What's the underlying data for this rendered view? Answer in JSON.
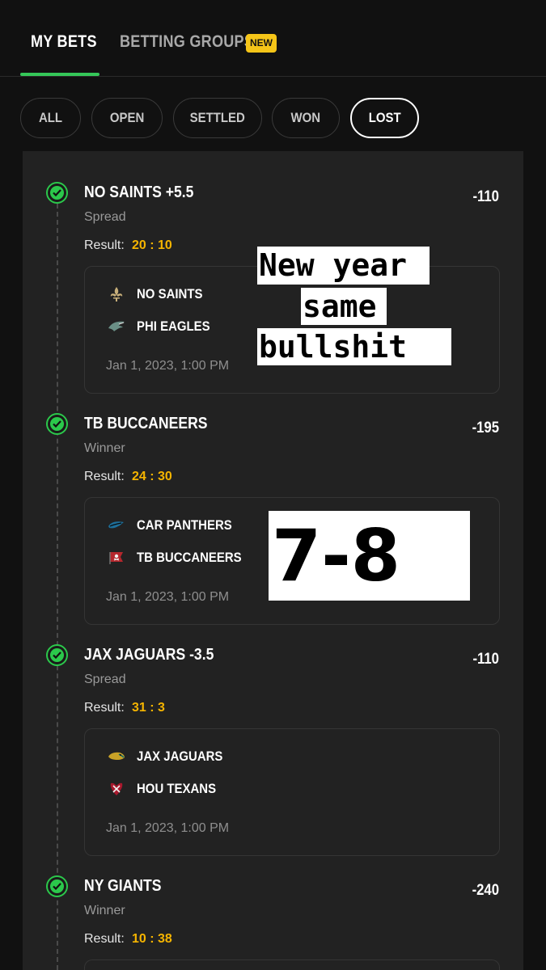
{
  "nav": {
    "tabs": [
      {
        "label": "MY BETS"
      },
      {
        "label": "BETTING GROUPS"
      }
    ],
    "new_badge": "NEW"
  },
  "filters": {
    "chips": [
      {
        "label": "ALL"
      },
      {
        "label": "OPEN"
      },
      {
        "label": "SETTLED"
      },
      {
        "label": "WON"
      },
      {
        "label": "LOST"
      }
    ],
    "selected": "LOST"
  },
  "bets": [
    {
      "title": "NO SAINTS +5.5",
      "odds": "-110",
      "type": "Spread",
      "result_label": "Result:",
      "result": "20 : 10",
      "teams": [
        {
          "name": "NO SAINTS",
          "icon": "saints-fleur-de-lis-icon"
        },
        {
          "name": "PHI EAGLES",
          "icon": "eagles-icon"
        }
      ],
      "date": "Jan 1, 2023, 1:00 PM"
    },
    {
      "title": "TB BUCCANEERS",
      "odds": "-195",
      "type": "Winner",
      "result_label": "Result:",
      "result": "24 : 30",
      "teams": [
        {
          "name": "CAR PANTHERS",
          "icon": "panthers-icon"
        },
        {
          "name": "TB BUCCANEERS",
          "icon": "buccaneers-flag-icon"
        }
      ],
      "date": "Jan 1, 2023, 1:00 PM"
    },
    {
      "title": "JAX JAGUARS -3.5",
      "odds": "-110",
      "type": "Spread",
      "result_label": "Result:",
      "result": "31 : 3",
      "teams": [
        {
          "name": "JAX JAGUARS",
          "icon": "jaguars-icon"
        },
        {
          "name": "HOU TEXANS",
          "icon": "texans-icon"
        }
      ],
      "date": "Jan 1, 2023, 1:00 PM"
    },
    {
      "title": "NY GIANTS",
      "odds": "-240",
      "type": "Winner",
      "result_label": "Result:",
      "result": "10 : 38"
    }
  ],
  "overlays": {
    "caption_lines": [
      "New year",
      "same",
      "bullshit"
    ],
    "record": "7-8"
  },
  "colors": {
    "accent_green": "#35c759",
    "check_green": "#2bc84b",
    "result_gold": "#f5b400",
    "badge_yellow": "#f5c518",
    "panel": "#222222",
    "background": "#111111"
  }
}
